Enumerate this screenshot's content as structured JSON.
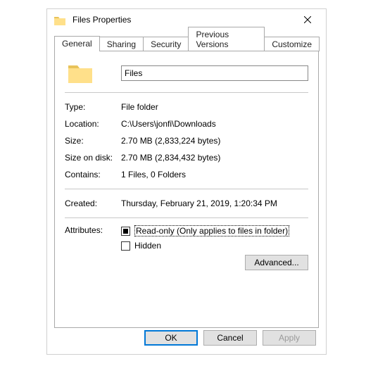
{
  "window": {
    "title": "Files Properties"
  },
  "tabs": {
    "general": "General",
    "sharing": "Sharing",
    "security": "Security",
    "previous_versions": "Previous Versions",
    "customize": "Customize"
  },
  "general": {
    "name": "Files",
    "labels": {
      "type": "Type:",
      "location": "Location:",
      "size": "Size:",
      "size_on_disk": "Size on disk:",
      "contains": "Contains:",
      "created": "Created:",
      "attributes": "Attributes:"
    },
    "values": {
      "type": "File folder",
      "location": "C:\\Users\\jonfi\\Downloads",
      "size": "2.70 MB (2,833,224 bytes)",
      "size_on_disk": "2.70 MB (2,834,432 bytes)",
      "contains": "1 Files, 0 Folders",
      "created": "Thursday, February 21, 2019, 1:20:34 PM"
    },
    "attributes": {
      "read_only": "Read-only (Only applies to files in folder)",
      "hidden": "Hidden",
      "advanced": "Advanced..."
    }
  },
  "buttons": {
    "ok": "OK",
    "cancel": "Cancel",
    "apply": "Apply"
  }
}
